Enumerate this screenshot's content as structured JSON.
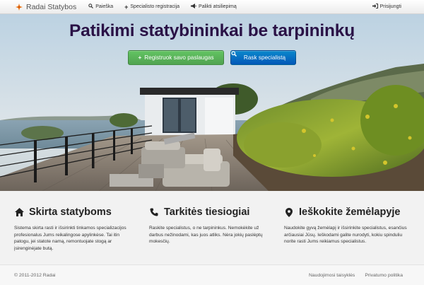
{
  "navbar": {
    "brand": "Radai Statybos",
    "items": [
      {
        "label": "Paieška",
        "icon": "search-icon"
      },
      {
        "label": "Specialisto registracija",
        "icon": "plus-icon"
      },
      {
        "label": "Palikti atsiliepimą",
        "icon": "bullhorn-icon"
      }
    ],
    "login": {
      "label": "Prisijungti",
      "icon": "login-icon"
    }
  },
  "hero": {
    "title": "Patikimi statybininkai be tarpininkų",
    "register_button": "Registruok savo paslaugas",
    "find_button": "Rask specialistą"
  },
  "features": [
    {
      "icon": "home-icon",
      "title": "Skirta statyboms",
      "text": "Sistema skirta rasti ir išsirinkti tinkamos specializacijos profesionalus Jums reikalingose apylinkėse. Tai itin patogu, jei statote namą, remontuojate stogą ar įsirenginėjate butą."
    },
    {
      "icon": "phone-icon",
      "title": "Tarkitės tiesiogiai",
      "text": "Raskite specialistus, o ne tarpininkus. Nemokėkite už darbus nežinodami, kas juos atliks. Nėra jokių paslėptų mokesčių."
    },
    {
      "icon": "map-marker-icon",
      "title": "Ieškokite žemėlapyje",
      "text": "Naudokite gyvą žemėlapį ir išsirinkite specialistus, esančius arčiausiai Jūsų. Ieškodami galite nurodyti, kokiu spinduliu norite rasti Jums reikiamus specialistus."
    }
  ],
  "footer": {
    "copyright": "© 2011-2012 Radai",
    "links": [
      "Naudojimosi taisyklės",
      "Privatumo politika"
    ]
  },
  "colors": {
    "title": "#2a1246",
    "green_button": "#51a351",
    "blue_button": "#0357b8",
    "brand_logo": "#f07a1a"
  }
}
